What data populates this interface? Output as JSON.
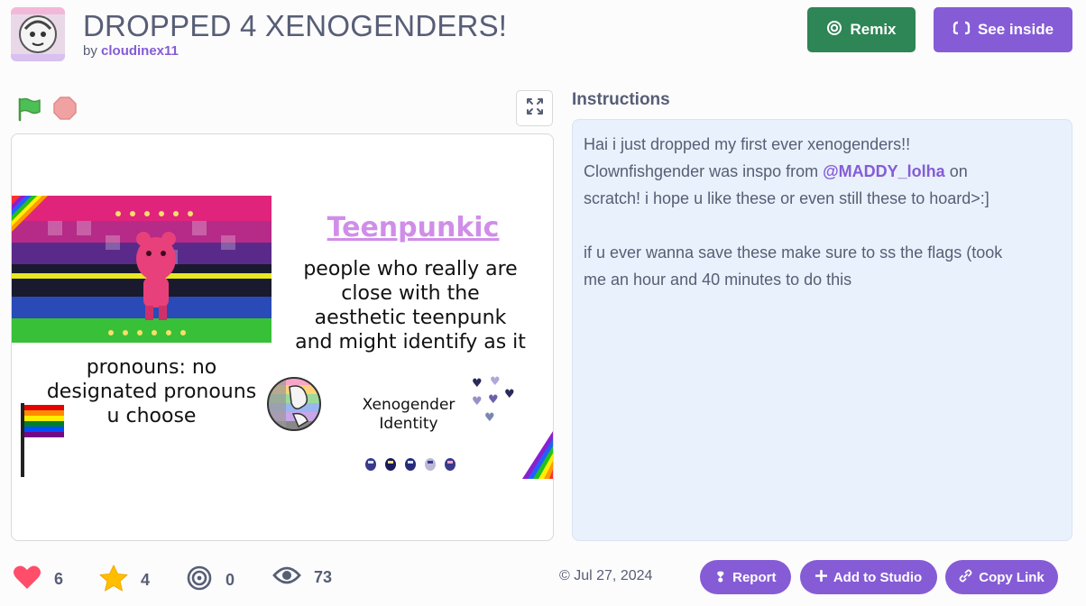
{
  "project": {
    "title": "DROPPED 4 XENOGENDERS!",
    "by_prefix": "by",
    "author": "cloudinex11"
  },
  "header_buttons": {
    "remix": "Remix",
    "see_inside": "See inside"
  },
  "stage_content": {
    "flag_name": "Teenpunkic",
    "description_lines": [
      "people who really are",
      "close with the",
      "aesthetic teenpunk",
      "and might identify as it"
    ],
    "pronoun_lines": [
      "pronouns: no",
      "designated pronouns",
      "u choose"
    ],
    "badge_lines": [
      "Xenogender",
      "Identity"
    ]
  },
  "instructions": {
    "heading": "Instructions",
    "line1": "Hai i just dropped my first ever xenogenders!!",
    "line2_before": "Clownfishgender was inspo from ",
    "mention": "@MADDY_lolha",
    "line2_after": " on",
    "line3": "scratch! i hope u like these or even still these to hoard>:]",
    "line5": "if u ever wanna save these make sure to ss the flags (took",
    "line6": "me an hour and 40 minutes to do this"
  },
  "stats": {
    "loves": "6",
    "favorites": "4",
    "remixes": "0",
    "views": "73"
  },
  "date": "© Jul 27, 2024",
  "actions": {
    "report": "Report",
    "add_to_studio": "Add to Studio",
    "copy_link": "Copy Link"
  },
  "colors": {
    "purple": "#855cd6",
    "green": "#2e8555",
    "text": "#575e75",
    "instructions_bg": "#e9f1fc"
  }
}
